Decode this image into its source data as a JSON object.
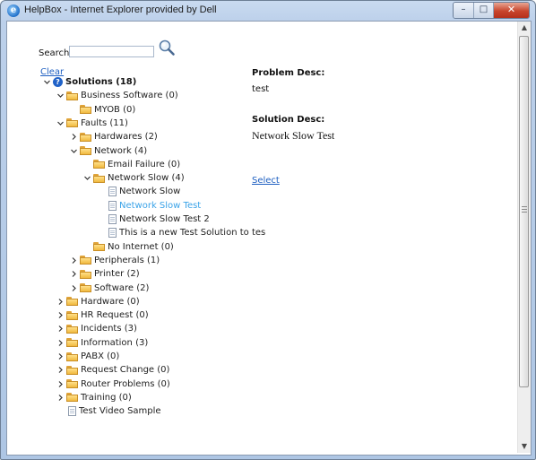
{
  "window": {
    "title": "HelpBox - Internet Explorer provided by Dell",
    "minimize_glyph": "–",
    "maximize_glyph": "□",
    "close_glyph": "✕"
  },
  "search": {
    "label": "Search",
    "value": "",
    "placeholder": ""
  },
  "clear_label": "Clear",
  "tree": [
    {
      "label": "Solutions (18)",
      "icon": "help-icon",
      "depth": 0,
      "state": "expanded",
      "root": true
    },
    {
      "label": "Business Software (0)",
      "icon": "folder-icon",
      "depth": 1,
      "state": "expanded"
    },
    {
      "label": "MYOB (0)",
      "icon": "folder-icon",
      "depth": 2,
      "state": "none"
    },
    {
      "label": "Faults (11)",
      "icon": "folder-icon",
      "depth": 1,
      "state": "expanded"
    },
    {
      "label": "Hardwares (2)",
      "icon": "folder-icon",
      "depth": 2,
      "state": "collapsed"
    },
    {
      "label": "Network (4)",
      "icon": "folder-icon",
      "depth": 2,
      "state": "expanded"
    },
    {
      "label": "Email Failure (0)",
      "icon": "folder-icon",
      "depth": 3,
      "state": "none"
    },
    {
      "label": "Network Slow (4)",
      "icon": "folder-icon",
      "depth": 3,
      "state": "expanded"
    },
    {
      "label": "Network Slow",
      "icon": "document-icon",
      "depth": 4,
      "state": "none"
    },
    {
      "label": "Network Slow Test",
      "icon": "document-icon",
      "depth": 4,
      "state": "none",
      "active": true
    },
    {
      "label": "Network Slow Test 2",
      "icon": "document-icon",
      "depth": 4,
      "state": "none"
    },
    {
      "label": "This is a new Test Solution to tes",
      "icon": "document-icon",
      "depth": 4,
      "state": "none"
    },
    {
      "label": "No Internet (0)",
      "icon": "folder-icon",
      "depth": 3,
      "state": "none"
    },
    {
      "label": "Peripherals (1)",
      "icon": "folder-icon",
      "depth": 2,
      "state": "collapsed"
    },
    {
      "label": "Printer (2)",
      "icon": "folder-icon",
      "depth": 2,
      "state": "collapsed"
    },
    {
      "label": "Software (2)",
      "icon": "folder-icon",
      "depth": 2,
      "state": "collapsed"
    },
    {
      "label": "Hardware (0)",
      "icon": "folder-icon",
      "depth": 1,
      "state": "collapsed"
    },
    {
      "label": "HR Request (0)",
      "icon": "folder-icon",
      "depth": 1,
      "state": "collapsed"
    },
    {
      "label": "Incidents (3)",
      "icon": "folder-icon",
      "depth": 1,
      "state": "collapsed"
    },
    {
      "label": "Information (3)",
      "icon": "folder-icon",
      "depth": 1,
      "state": "collapsed"
    },
    {
      "label": "PABX (0)",
      "icon": "folder-icon",
      "depth": 1,
      "state": "collapsed"
    },
    {
      "label": "Request Change (0)",
      "icon": "folder-icon",
      "depth": 1,
      "state": "collapsed"
    },
    {
      "label": "Router Problems (0)",
      "icon": "folder-icon",
      "depth": 1,
      "state": "collapsed"
    },
    {
      "label": "Training (0)",
      "icon": "folder-icon",
      "depth": 1,
      "state": "collapsed"
    },
    {
      "label": "Test Video Sample",
      "icon": "document-icon",
      "depth": 1,
      "state": "none"
    }
  ],
  "details": {
    "problem_label": "Problem Desc:",
    "problem_value": "test",
    "solution_label": "Solution Desc:",
    "solution_value": "Network Slow Test",
    "select_label": "Select"
  },
  "colors": {
    "link": "#1e5fc1",
    "active_item": "#3aa3e8"
  }
}
